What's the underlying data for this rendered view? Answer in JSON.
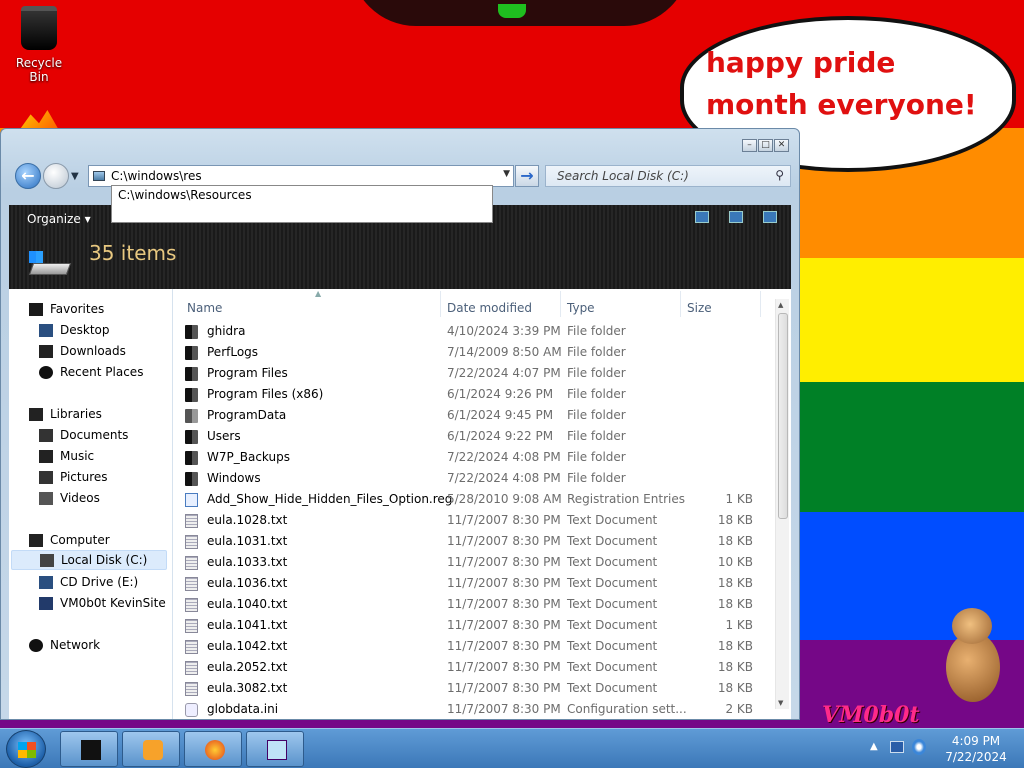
{
  "desktop": {
    "recycle_bin_label": "Recycle Bin",
    "speech_bubble": "happy pride month everyone!",
    "watermark": "VM0b0t"
  },
  "window": {
    "caption_buttons": [
      "minimize",
      "maximize",
      "close"
    ],
    "address_value": "C:\\windows\\res",
    "address_suggestion": "C:\\windows\\Resources",
    "search_placeholder": "Search Local Disk (C:)",
    "organize_label": "Organize",
    "item_count": "35 items"
  },
  "nav_pane": {
    "favorites": "Favorites",
    "desktop": "Desktop",
    "downloads": "Downloads",
    "recent_places": "Recent Places",
    "libraries": "Libraries",
    "documents": "Documents",
    "music": "Music",
    "pictures": "Pictures",
    "videos": "Videos",
    "computer": "Computer",
    "local_disk": "Local Disk (C:)",
    "cd_drive": "CD Drive (E:)",
    "vm_site": "VM0b0t KevinSite",
    "network": "Network"
  },
  "columns": {
    "name": "Name",
    "date_modified": "Date modified",
    "type": "Type",
    "size": "Size"
  },
  "files": [
    {
      "name": "ghidra",
      "date": "4/10/2024 3:39 PM",
      "type": "File folder",
      "size": "",
      "icon": "folder-icon"
    },
    {
      "name": "PerfLogs",
      "date": "7/14/2009 8:50 AM",
      "type": "File folder",
      "size": "",
      "icon": "folder-icon"
    },
    {
      "name": "Program Files",
      "date": "7/22/2024 4:07 PM",
      "type": "File folder",
      "size": "",
      "icon": "folder-icon"
    },
    {
      "name": "Program Files (x86)",
      "date": "6/1/2024 9:26 PM",
      "type": "File folder",
      "size": "",
      "icon": "folder-icon"
    },
    {
      "name": "ProgramData",
      "date": "6/1/2024 9:45 PM",
      "type": "File folder",
      "size": "",
      "icon": "folder-icon"
    },
    {
      "name": "Users",
      "date": "6/1/2024 9:22 PM",
      "type": "File folder",
      "size": "",
      "icon": "folder-icon"
    },
    {
      "name": "W7P_Backups",
      "date": "7/22/2024 4:08 PM",
      "type": "File folder",
      "size": "",
      "icon": "folder-icon"
    },
    {
      "name": "Windows",
      "date": "7/22/2024 4:08 PM",
      "type": "File folder",
      "size": "",
      "icon": "folder-icon"
    },
    {
      "name": "Add_Show_Hide_Hidden_Files_Option.reg",
      "date": "5/28/2010 9:08 AM",
      "type": "Registration Entries",
      "size": "1 KB",
      "icon": "registry-file-icon"
    },
    {
      "name": "eula.1028.txt",
      "date": "11/7/2007 8:30 PM",
      "type": "Text Document",
      "size": "18 KB",
      "icon": "text-file-icon"
    },
    {
      "name": "eula.1031.txt",
      "date": "11/7/2007 8:30 PM",
      "type": "Text Document",
      "size": "18 KB",
      "icon": "text-file-icon"
    },
    {
      "name": "eula.1033.txt",
      "date": "11/7/2007 8:30 PM",
      "type": "Text Document",
      "size": "10 KB",
      "icon": "text-file-icon"
    },
    {
      "name": "eula.1036.txt",
      "date": "11/7/2007 8:30 PM",
      "type": "Text Document",
      "size": "18 KB",
      "icon": "text-file-icon"
    },
    {
      "name": "eula.1040.txt",
      "date": "11/7/2007 8:30 PM",
      "type": "Text Document",
      "size": "18 KB",
      "icon": "text-file-icon"
    },
    {
      "name": "eula.1041.txt",
      "date": "11/7/2007 8:30 PM",
      "type": "Text Document",
      "size": "1 KB",
      "icon": "text-file-icon"
    },
    {
      "name": "eula.1042.txt",
      "date": "11/7/2007 8:30 PM",
      "type": "Text Document",
      "size": "18 KB",
      "icon": "text-file-icon"
    },
    {
      "name": "eula.2052.txt",
      "date": "11/7/2007 8:30 PM",
      "type": "Text Document",
      "size": "18 KB",
      "icon": "text-file-icon"
    },
    {
      "name": "eula.3082.txt",
      "date": "11/7/2007 8:30 PM",
      "type": "Text Document",
      "size": "18 KB",
      "icon": "text-file-icon"
    },
    {
      "name": "globdata.ini",
      "date": "11/7/2007 8:30 PM",
      "type": "Configuration sett...",
      "size": "2 KB",
      "icon": "config-file-icon"
    }
  ],
  "taskbar": {
    "time": "4:09 PM",
    "date": "7/22/2024"
  },
  "colors": {
    "pride_red": "#e50000",
    "pride_orange": "#ff8c00",
    "pride_yellow": "#ffee00",
    "pride_green": "#008026",
    "pride_blue": "#004dff",
    "pride_purple": "#750787",
    "bubble_text": "#e01010",
    "item_count_text": "#e8c880"
  }
}
